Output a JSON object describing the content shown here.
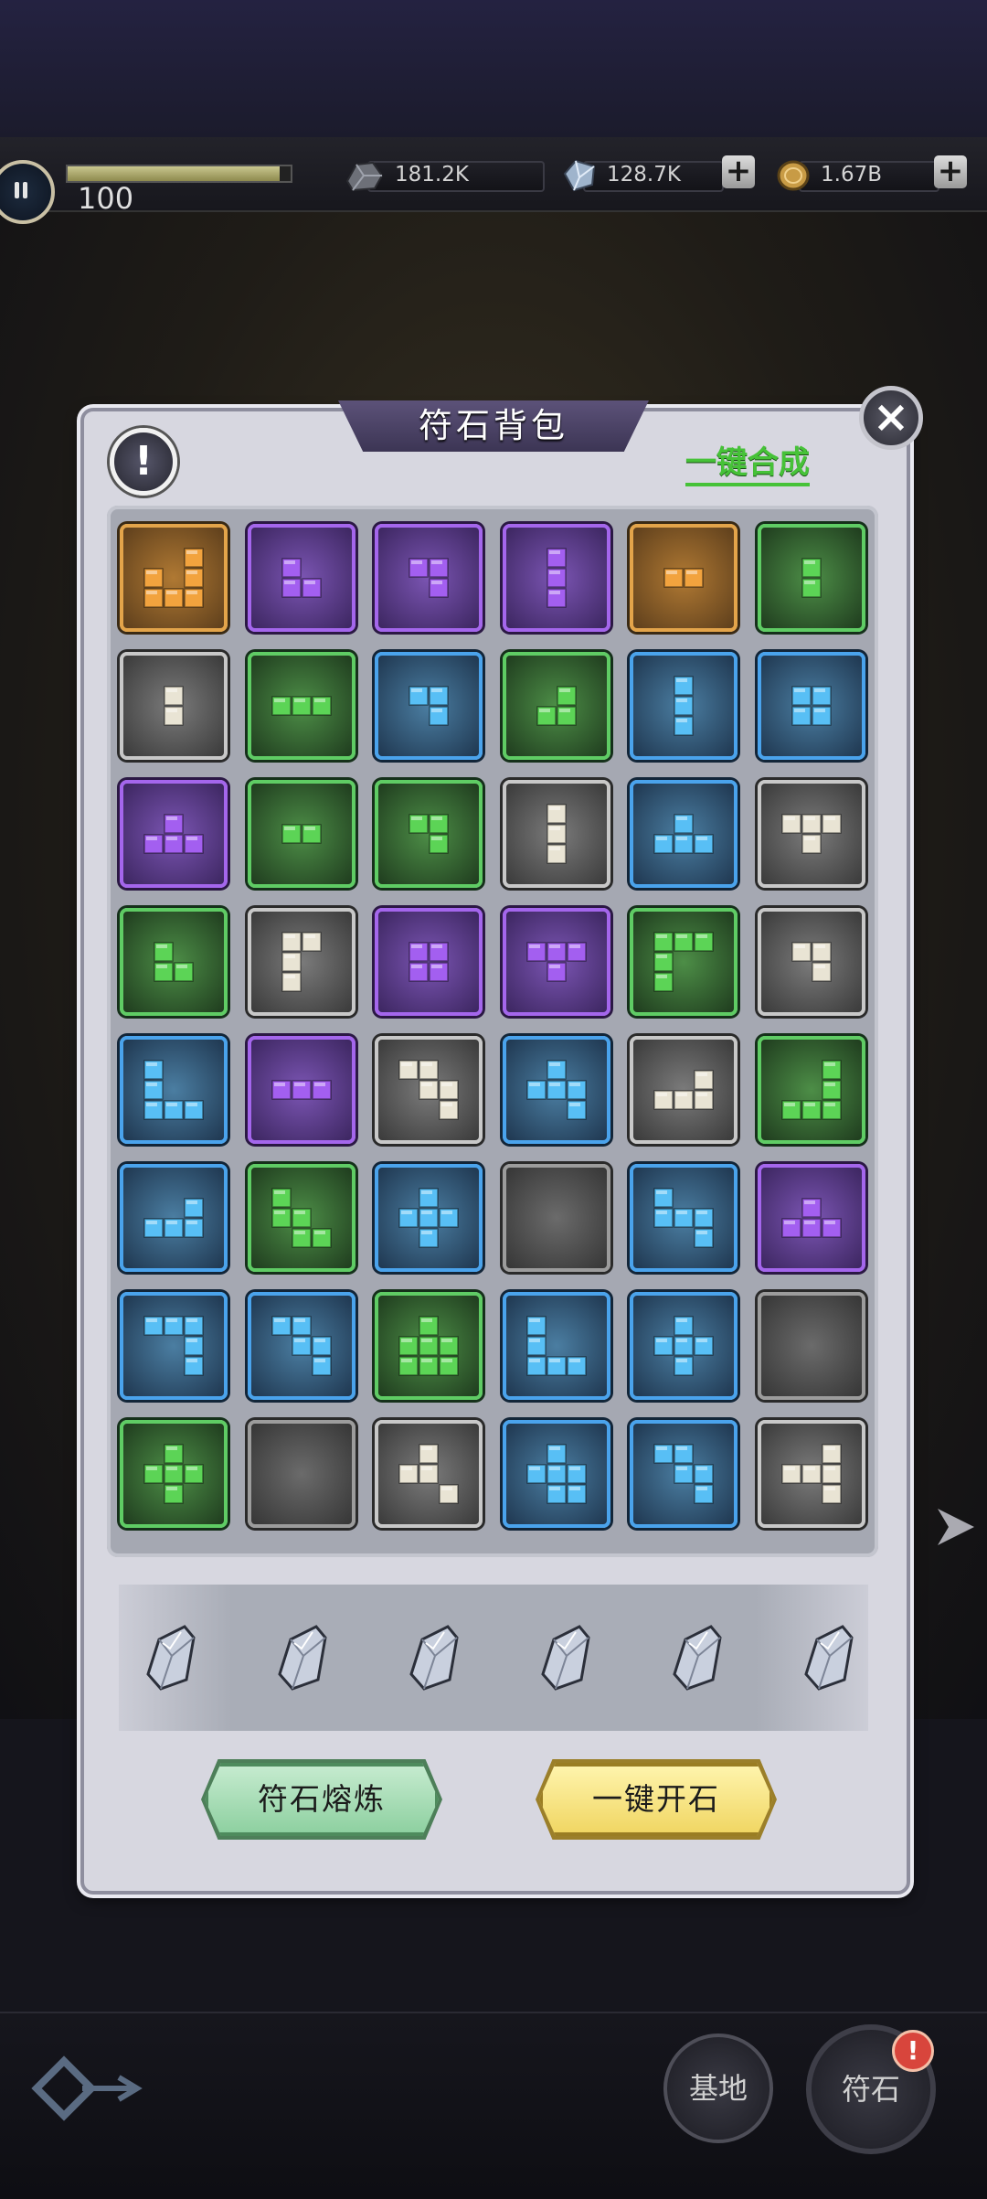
{
  "top_bar": {
    "level": "100",
    "xp_fraction": 0.95,
    "resources": [
      {
        "icon": "ore-icon",
        "value": "181.2K"
      },
      {
        "icon": "crystal-icon",
        "value": "128.7K"
      },
      {
        "icon": "coin-icon",
        "value": "1.67B"
      }
    ]
  },
  "panel": {
    "title": "符石背包",
    "merge_all": "一键合成",
    "info_icon": "exclamation-icon",
    "close_icon": "close-icon"
  },
  "rune_grid": {
    "columns": 6,
    "rows": 8,
    "cells": [
      {
        "color": "orange",
        "shape": [
          [
            0,
            2
          ],
          [
            1,
            2
          ],
          [
            2,
            1
          ],
          [
            2,
            2
          ],
          [
            1,
            0
          ],
          [
            2,
            0
          ]
        ]
      },
      {
        "color": "purple",
        "shape": [
          [
            0,
            0
          ],
          [
            1,
            0
          ],
          [
            1,
            1
          ]
        ]
      },
      {
        "color": "purple",
        "shape": [
          [
            0,
            0
          ],
          [
            0,
            1
          ],
          [
            1,
            1
          ]
        ]
      },
      {
        "color": "purple",
        "shape": [
          [
            0,
            0
          ],
          [
            1,
            0
          ],
          [
            2,
            0
          ]
        ]
      },
      {
        "color": "orange",
        "shape": [
          [
            0,
            0
          ],
          [
            0,
            1
          ]
        ]
      },
      {
        "color": "green",
        "shape": [
          [
            0,
            0
          ],
          [
            1,
            0
          ]
        ]
      },
      {
        "color": "white",
        "shape": [
          [
            0,
            0
          ],
          [
            1,
            0
          ]
        ]
      },
      {
        "color": "green",
        "shape": [
          [
            0,
            0
          ],
          [
            0,
            1
          ],
          [
            0,
            2
          ]
        ]
      },
      {
        "color": "blue",
        "shape": [
          [
            0,
            0
          ],
          [
            0,
            1
          ],
          [
            1,
            1
          ]
        ]
      },
      {
        "color": "green",
        "shape": [
          [
            0,
            1
          ],
          [
            1,
            0
          ],
          [
            1,
            1
          ]
        ]
      },
      {
        "color": "blue",
        "shape": [
          [
            0,
            0
          ],
          [
            1,
            0
          ],
          [
            2,
            0
          ]
        ]
      },
      {
        "color": "blue",
        "shape": [
          [
            0,
            0
          ],
          [
            0,
            1
          ],
          [
            1,
            0
          ],
          [
            1,
            1
          ]
        ]
      },
      {
        "color": "purple",
        "shape": [
          [
            0,
            1
          ],
          [
            1,
            0
          ],
          [
            1,
            1
          ],
          [
            1,
            2
          ]
        ]
      },
      {
        "color": "green",
        "shape": [
          [
            0,
            0
          ],
          [
            0,
            1
          ]
        ]
      },
      {
        "color": "green",
        "shape": [
          [
            0,
            0
          ],
          [
            0,
            1
          ],
          [
            1,
            1
          ]
        ]
      },
      {
        "color": "white",
        "shape": [
          [
            0,
            0
          ],
          [
            1,
            0
          ],
          [
            2,
            0
          ]
        ]
      },
      {
        "color": "blue",
        "shape": [
          [
            0,
            1
          ],
          [
            1,
            0
          ],
          [
            1,
            1
          ],
          [
            1,
            2
          ]
        ]
      },
      {
        "color": "white",
        "shape": [
          [
            0,
            0
          ],
          [
            0,
            1
          ],
          [
            0,
            2
          ],
          [
            1,
            1
          ]
        ]
      },
      {
        "color": "green",
        "shape": [
          [
            0,
            0
          ],
          [
            1,
            0
          ],
          [
            1,
            1
          ]
        ]
      },
      {
        "color": "white",
        "shape": [
          [
            0,
            0
          ],
          [
            0,
            1
          ],
          [
            1,
            0
          ],
          [
            2,
            0
          ]
        ]
      },
      {
        "color": "purple",
        "shape": [
          [
            0,
            0
          ],
          [
            0,
            1
          ],
          [
            1,
            0
          ],
          [
            1,
            1
          ]
        ]
      },
      {
        "color": "purple",
        "shape": [
          [
            0,
            0
          ],
          [
            0,
            1
          ],
          [
            0,
            2
          ],
          [
            1,
            1
          ]
        ]
      },
      {
        "color": "green",
        "shape": [
          [
            0,
            0
          ],
          [
            0,
            1
          ],
          [
            0,
            2
          ],
          [
            1,
            0
          ],
          [
            2,
            0
          ]
        ]
      },
      {
        "color": "white",
        "shape": [
          [
            0,
            0
          ],
          [
            0,
            1
          ],
          [
            1,
            1
          ]
        ]
      },
      {
        "color": "blue",
        "shape": [
          [
            0,
            0
          ],
          [
            1,
            0
          ],
          [
            2,
            0
          ],
          [
            2,
            1
          ],
          [
            2,
            2
          ]
        ]
      },
      {
        "color": "purple",
        "shape": [
          [
            0,
            0
          ],
          [
            0,
            1
          ],
          [
            0,
            2
          ]
        ]
      },
      {
        "color": "white",
        "shape": [
          [
            0,
            0
          ],
          [
            0,
            1
          ],
          [
            1,
            1
          ],
          [
            1,
            2
          ],
          [
            2,
            2
          ]
        ]
      },
      {
        "color": "blue",
        "shape": [
          [
            0,
            1
          ],
          [
            1,
            0
          ],
          [
            1,
            1
          ],
          [
            1,
            2
          ],
          [
            2,
            2
          ]
        ]
      },
      {
        "color": "white",
        "shape": [
          [
            0,
            2
          ],
          [
            1,
            0
          ],
          [
            1,
            1
          ],
          [
            1,
            2
          ]
        ]
      },
      {
        "color": "green",
        "shape": [
          [
            0,
            2
          ],
          [
            1,
            2
          ],
          [
            2,
            0
          ],
          [
            2,
            1
          ],
          [
            2,
            2
          ]
        ]
      },
      {
        "color": "blue",
        "shape": [
          [
            0,
            2
          ],
          [
            1,
            0
          ],
          [
            1,
            1
          ],
          [
            1,
            2
          ]
        ]
      },
      {
        "color": "green",
        "shape": [
          [
            0,
            0
          ],
          [
            1,
            0
          ],
          [
            1,
            1
          ],
          [
            2,
            1
          ],
          [
            2,
            2
          ]
        ]
      },
      {
        "color": "blue",
        "shape": [
          [
            0,
            1
          ],
          [
            1,
            0
          ],
          [
            1,
            1
          ],
          [
            1,
            2
          ],
          [
            2,
            1
          ]
        ]
      },
      {
        "color": "empty",
        "shape": []
      },
      {
        "color": "blue",
        "shape": [
          [
            0,
            0
          ],
          [
            1,
            0
          ],
          [
            1,
            1
          ],
          [
            1,
            2
          ],
          [
            2,
            2
          ]
        ]
      },
      {
        "color": "purple",
        "shape": [
          [
            0,
            1
          ],
          [
            1,
            0
          ],
          [
            1,
            1
          ],
          [
            1,
            2
          ]
        ]
      },
      {
        "color": "blue",
        "shape": [
          [
            0,
            0
          ],
          [
            0,
            1
          ],
          [
            0,
            2
          ],
          [
            1,
            2
          ],
          [
            2,
            2
          ]
        ]
      },
      {
        "color": "blue",
        "shape": [
          [
            0,
            0
          ],
          [
            0,
            1
          ],
          [
            1,
            1
          ],
          [
            1,
            2
          ],
          [
            2,
            2
          ]
        ]
      },
      {
        "color": "green",
        "shape": [
          [
            0,
            1
          ],
          [
            1,
            0
          ],
          [
            1,
            1
          ],
          [
            1,
            2
          ],
          [
            2,
            0
          ],
          [
            2,
            1
          ],
          [
            2,
            2
          ]
        ]
      },
      {
        "color": "blue",
        "shape": [
          [
            0,
            0
          ],
          [
            1,
            0
          ],
          [
            2,
            0
          ],
          [
            2,
            1
          ],
          [
            2,
            2
          ]
        ]
      },
      {
        "color": "blue",
        "shape": [
          [
            0,
            1
          ],
          [
            1,
            0
          ],
          [
            1,
            1
          ],
          [
            1,
            2
          ],
          [
            2,
            1
          ]
        ]
      },
      {
        "color": "empty",
        "shape": []
      },
      {
        "color": "green",
        "shape": [
          [
            0,
            1
          ],
          [
            1,
            0
          ],
          [
            1,
            1
          ],
          [
            1,
            2
          ],
          [
            2,
            1
          ]
        ]
      },
      {
        "color": "empty",
        "shape": []
      },
      {
        "color": "white",
        "shape": [
          [
            0,
            1
          ],
          [
            1,
            0
          ],
          [
            1,
            1
          ],
          [
            2,
            2
          ]
        ]
      },
      {
        "color": "blue",
        "shape": [
          [
            0,
            1
          ],
          [
            1,
            0
          ],
          [
            1,
            1
          ],
          [
            1,
            2
          ],
          [
            2,
            1
          ],
          [
            2,
            2
          ]
        ]
      },
      {
        "color": "blue",
        "shape": [
          [
            0,
            0
          ],
          [
            0,
            1
          ],
          [
            1,
            1
          ],
          [
            1,
            2
          ],
          [
            2,
            2
          ]
        ]
      },
      {
        "color": "white",
        "shape": [
          [
            0,
            2
          ],
          [
            1,
            0
          ],
          [
            1,
            1
          ],
          [
            1,
            2
          ],
          [
            2,
            2
          ]
        ]
      }
    ]
  },
  "crystal_slots": {
    "count": 6,
    "icon": "rune-crystal-icon"
  },
  "actions": {
    "smelt_label": "符石熔炼",
    "open_all_label": "一键开石"
  },
  "bottom_nav": {
    "base_label": "基地",
    "rune_label": "符石",
    "rune_badge": "!"
  },
  "colors": {
    "orange": "#f2a33e",
    "purple": "#a35ff0",
    "green": "#5cd456",
    "blue": "#58bff5",
    "white": "#e9e4d4"
  }
}
